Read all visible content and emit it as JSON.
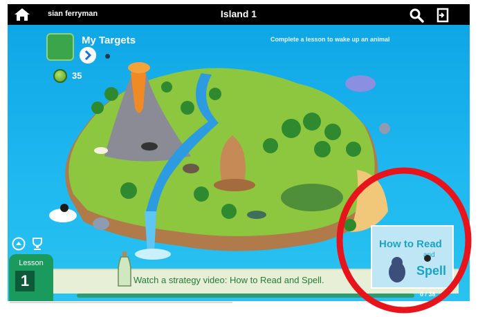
{
  "topbar": {
    "username": "sian ferryman",
    "title": "Island 1",
    "home_icon": "home-icon",
    "search_icon": "search-icon",
    "logout_icon": "logout-icon"
  },
  "targets": {
    "title": "My Targets",
    "coins": "35",
    "hint": "Complete a lesson to wake up an animal"
  },
  "lesson": {
    "label": "Lesson",
    "number": "1"
  },
  "video": {
    "text": "Watch a strategy video: How to Read and Spell.",
    "thumb_line1": "How to Read",
    "thumb_line2": "and",
    "thumb_line3": "Spell"
  },
  "progress": {
    "text": "0 / 38",
    "fraction": 0
  },
  "colors": {
    "ocean": "#1fb8f0",
    "lesson_green": "#1b9a5e",
    "highlight": "#e8141b"
  }
}
